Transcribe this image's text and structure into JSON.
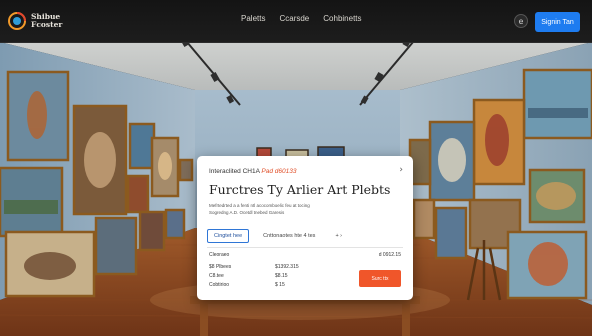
{
  "brand": {
    "name_line1": "Shibue",
    "name_line2": "Fcoster"
  },
  "nav": {
    "items": [
      {
        "label": "Paletts"
      },
      {
        "label": "Ccarsde"
      },
      {
        "label": "Cohbinetts"
      }
    ]
  },
  "header": {
    "settings_icon": "circle-e-icon",
    "signin_label": "Signin Tan"
  },
  "card": {
    "eyebrow_prefix": "Interaclited CH1A",
    "eyebrow_accent": "Pad d60133",
    "close_glyph": "›",
    "title": "Furctres Ty Arlier Art Plebts",
    "description": [
      "Mefrtedrted a a fenti ntl acocomboelic feu at tocing",
      "Sogredng A.D. Ocetdl tnebed Garesis"
    ],
    "tabs": [
      {
        "label": "Cingtet hee",
        "active": true
      },
      {
        "label": "Cnttonaotes hte 4 tes",
        "active": false
      },
      {
        "label": "+ ›",
        "active": false
      }
    ],
    "rows": [
      {
        "label": "Cleoraeo",
        "value": "",
        "right": "d 0912.15"
      },
      {
        "label": "$8 Plbees",
        "value": "$1392.315",
        "right": ""
      },
      {
        "label": "C8.tee",
        "value": "$8.15",
        "right": ""
      },
      {
        "label": "Cobtirioo",
        "value": "$ 15",
        "right": ""
      }
    ],
    "buy_label": "Surc ttx"
  },
  "colors": {
    "accent": "#e0502a",
    "primary": "#1e7cf0",
    "buy": "#f0562a"
  }
}
